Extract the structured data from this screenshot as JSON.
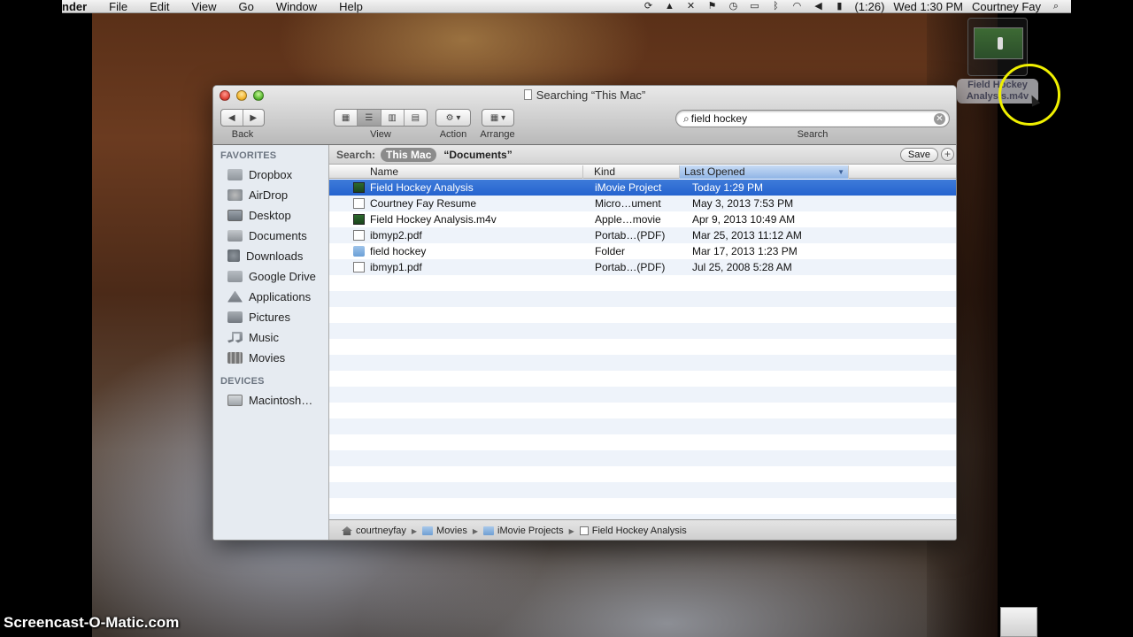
{
  "menubar": {
    "app": "nder",
    "items": [
      "File",
      "Edit",
      "View",
      "Go",
      "Window",
      "Help"
    ],
    "battery": "(1:26)",
    "clock": "Wed 1:30 PM",
    "user": "Courtney Fay"
  },
  "drag": {
    "label": "Field Hockey Analysis.m4v"
  },
  "window": {
    "title": "Searching “This Mac”",
    "toolbar": {
      "back_label": "Back",
      "view_label": "View",
      "action_label": "Action",
      "arrange_label": "Arrange",
      "search_label": "Search",
      "search_value": "field hockey"
    },
    "sidebar": {
      "favorites_heading": "FAVORITES",
      "favorites": [
        {
          "label": "Dropbox",
          "icon": "dropbox-icon"
        },
        {
          "label": "AirDrop",
          "icon": "airdrop-icon"
        },
        {
          "label": "Desktop",
          "icon": "desktop-icon"
        },
        {
          "label": "Documents",
          "icon": "documents-icon"
        },
        {
          "label": "Downloads",
          "icon": "downloads-icon"
        },
        {
          "label": "Google Drive",
          "icon": "folder-icon"
        },
        {
          "label": "Applications",
          "icon": "applications-icon"
        },
        {
          "label": "Pictures",
          "icon": "camera-icon"
        },
        {
          "label": "Music",
          "icon": "music-icon"
        },
        {
          "label": "Movies",
          "icon": "film-icon"
        }
      ],
      "devices_heading": "DEVICES",
      "devices": [
        {
          "label": "Macintosh…",
          "icon": "hard-drive-icon"
        }
      ]
    },
    "scope": {
      "label": "Search:",
      "this_mac": "This Mac",
      "documents": "“Documents”",
      "save_label": "Save",
      "add_label": "+"
    },
    "columns": {
      "name": "Name",
      "kind": "Kind",
      "last_opened": "Last Opened"
    },
    "rows": [
      {
        "name": "Field Hockey Analysis",
        "kind": "iMovie Project",
        "date": "Today 1:29 PM",
        "icon": "imovie-project-icon",
        "selected": true
      },
      {
        "name": "Courtney Fay Resume",
        "kind": "Micro…ument",
        "date": "May 3, 2013 7:53 PM",
        "icon": "document-icon",
        "selected": false
      },
      {
        "name": "Field Hockey Analysis.m4v",
        "kind": "Apple…movie",
        "date": "Apr 9, 2013 10:49 AM",
        "icon": "movie-icon",
        "selected": false
      },
      {
        "name": "ibmyp2.pdf",
        "kind": "Portab…(PDF)",
        "date": "Mar 25, 2013 11:12 AM",
        "icon": "pdf-icon",
        "selected": false
      },
      {
        "name": "field hockey",
        "kind": "Folder",
        "date": "Mar 17, 2013 1:23 PM",
        "icon": "folder-icon",
        "selected": false
      },
      {
        "name": "ibmyp1.pdf",
        "kind": "Portab…(PDF)",
        "date": "Jul 25, 2008 5:28 AM",
        "icon": "pdf-icon",
        "selected": false
      }
    ],
    "path": [
      "courtneyfay",
      "Movies",
      "iMovie Projects",
      "Field Hockey Analysis"
    ]
  },
  "watermark": "Screencast-O-Matic.com"
}
